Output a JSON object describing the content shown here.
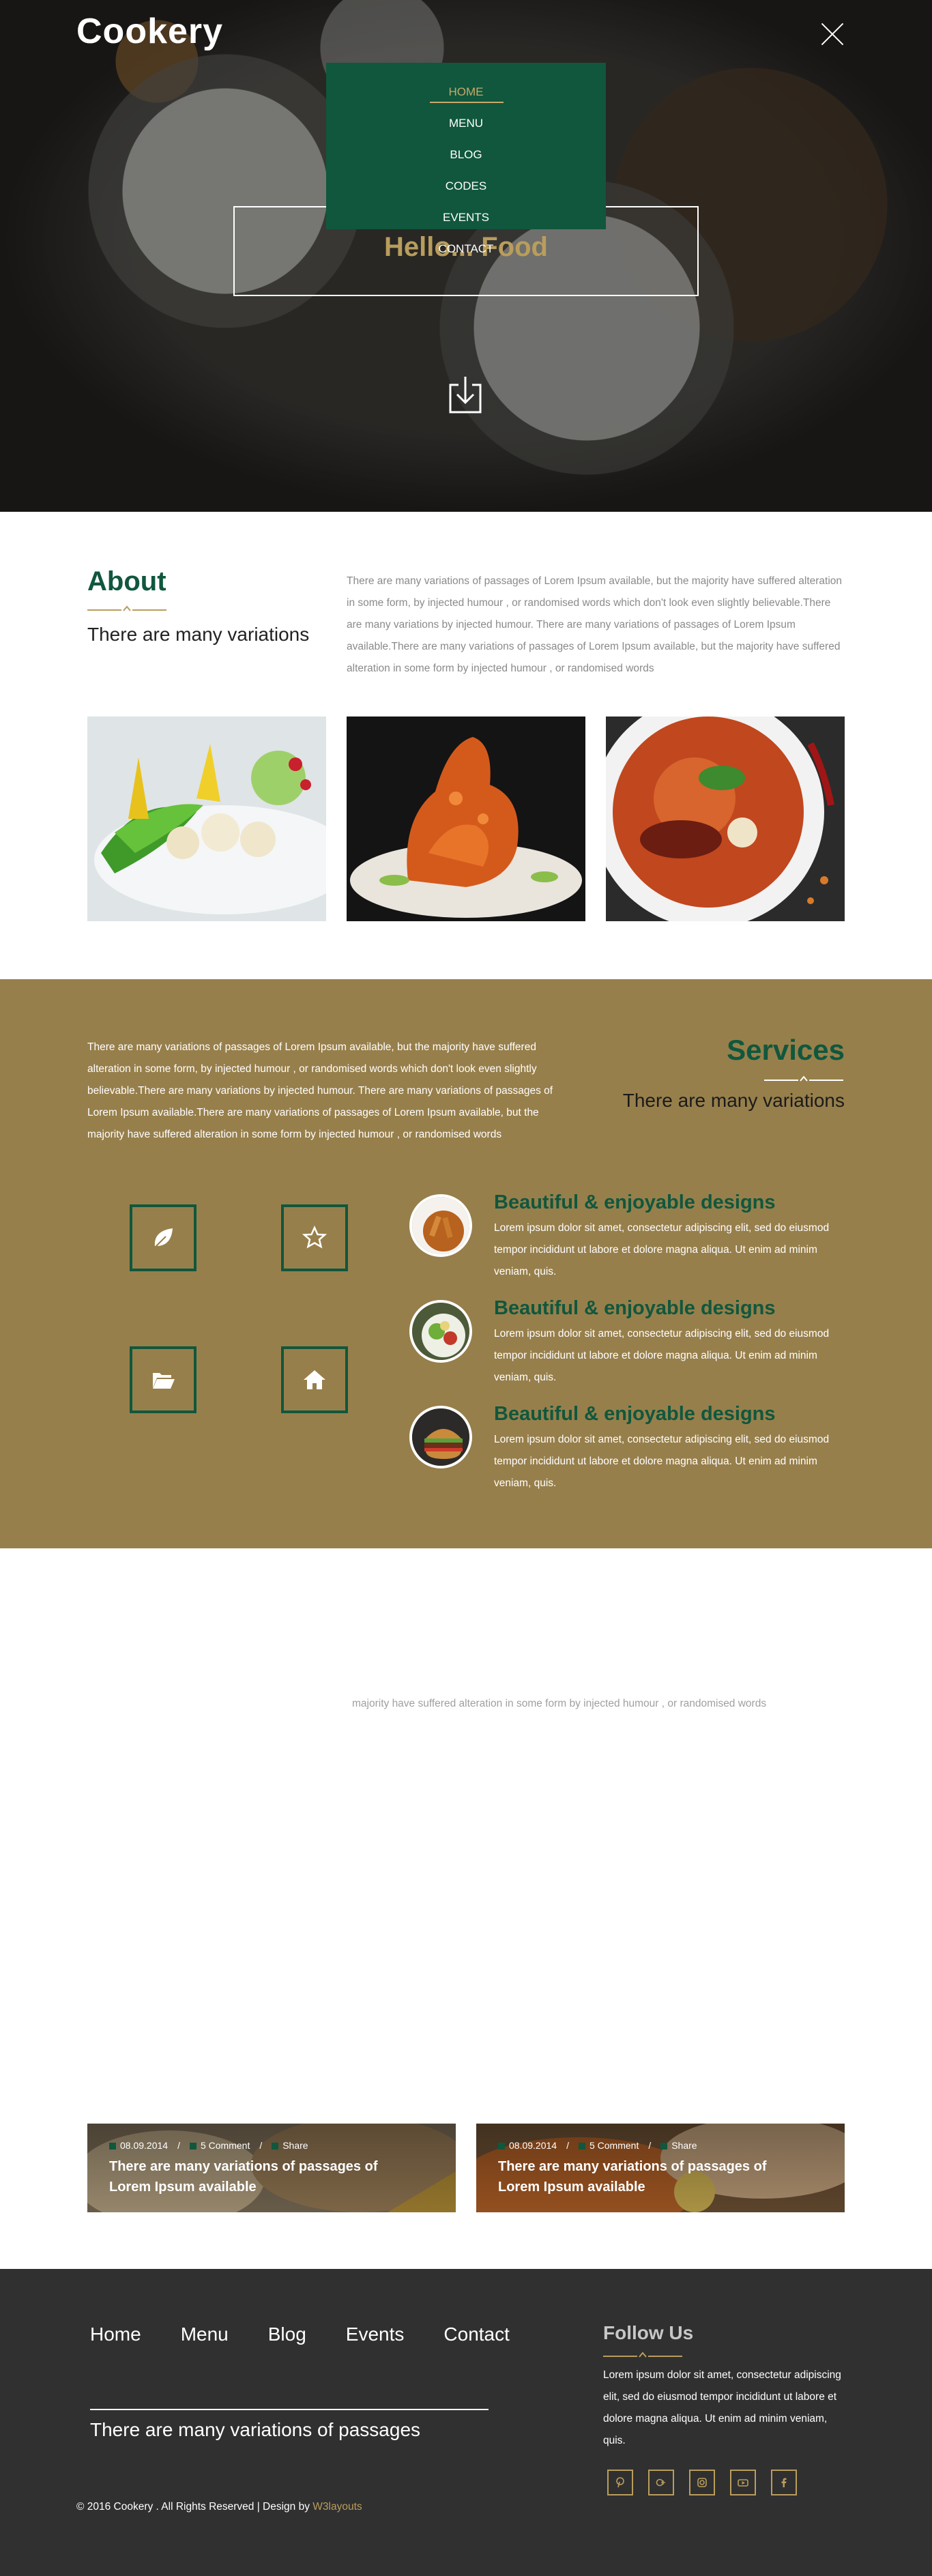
{
  "colors": {
    "green": "#10573d",
    "gold": "#b99d5c",
    "services_bg": "#977f4b",
    "footer_bg": "#303030"
  },
  "header": {
    "logo": "Cookery",
    "banner_text": "Hello... Food",
    "nav": [
      "HOME",
      "MENU",
      "BLOG",
      "CODES",
      "EVENTS",
      "CONTACT"
    ],
    "active_nav": "HOME",
    "icons": [
      "close-icon",
      "download-icon"
    ]
  },
  "about": {
    "title": "About",
    "subtitle": "There are many variations",
    "paragraph": "There are many variations of passages of Lorem Ipsum available, but the majority have suffered alteration in some form, by injected humour , or randomised words which don't look even slightly believable.There are many variations by injected humour. There are many variations of passages of Lorem Ipsum available.There are many variations of passages of Lorem Ipsum available, but the majority have suffered alteration in some form by injected humour , or randomised words",
    "photos": [
      "appetizer-photo",
      "fried-chicken-photo",
      "curry-soup-photo"
    ]
  },
  "services": {
    "paragraph": "There are many variations of passages of Lorem Ipsum available, but the majority have suffered alteration in some form, by injected humour , or randomised words which don't look even slightly believable.There are many variations by injected humour. There are many variations of passages of Lorem Ipsum available.There are many variations of passages of Lorem Ipsum available, but the majority have suffered alteration in some form by injected humour , or randomised words",
    "title": "Services",
    "subtitle": "There are many variations",
    "icon_boxes": [
      "leaf-icon",
      "star-icon",
      "folder-open-icon",
      "home-icon"
    ],
    "features": [
      {
        "title": "Beautiful & enjoyable designs",
        "text": "Lorem ipsum dolor sit amet, consectetur adipiscing elit, sed do eiusmod tempor incididunt ut labore et dolore magna aliqua. Ut enim ad minim veniam, quis."
      },
      {
        "title": "Beautiful & enjoyable designs",
        "text": "Lorem ipsum dolor sit amet, consectetur adipiscing elit, sed do eiusmod tempor incididunt ut labore et dolore magna aliqua. Ut enim ad minim veniam, quis."
      },
      {
        "title": "Beautiful & enjoyable designs",
        "text": "Lorem ipsum dolor sit amet, consectetur adipiscing elit, sed do eiusmod tempor incididunt ut labore et dolore magna aliqua. Ut enim ad minim veniam, quis."
      }
    ]
  },
  "middle": {
    "text": "majority have suffered alteration in some form by injected humour , or randomised words"
  },
  "blog": {
    "cards": [
      {
        "date": "08.09.2014",
        "comments": "5 Comment",
        "share": "Share",
        "title": "There are many variations of passages of Lorem Ipsum available"
      },
      {
        "date": "08.09.2014",
        "comments": "5 Comment",
        "share": "Share",
        "title": "There are many variations of passages of Lorem Ipsum available"
      }
    ]
  },
  "footer": {
    "nav": [
      "Home",
      "Menu",
      "Blog",
      "Events",
      "Contact"
    ],
    "subtitle": "There are many variations of passages",
    "follow_title": "Follow Us",
    "follow_text": "Lorem ipsum dolor sit amet, consectetur adipiscing elit, sed do eiusmod tempor incididunt ut labore et dolore magna aliqua. Ut enim ad minim veniam, quis.",
    "socials": [
      "pinterest-icon",
      "google-plus-icon",
      "instagram-icon",
      "youtube-icon",
      "facebook-icon"
    ],
    "copyright": "© 2016 Cookery . All Rights Reserved | Design by",
    "designer": "W3layouts"
  }
}
